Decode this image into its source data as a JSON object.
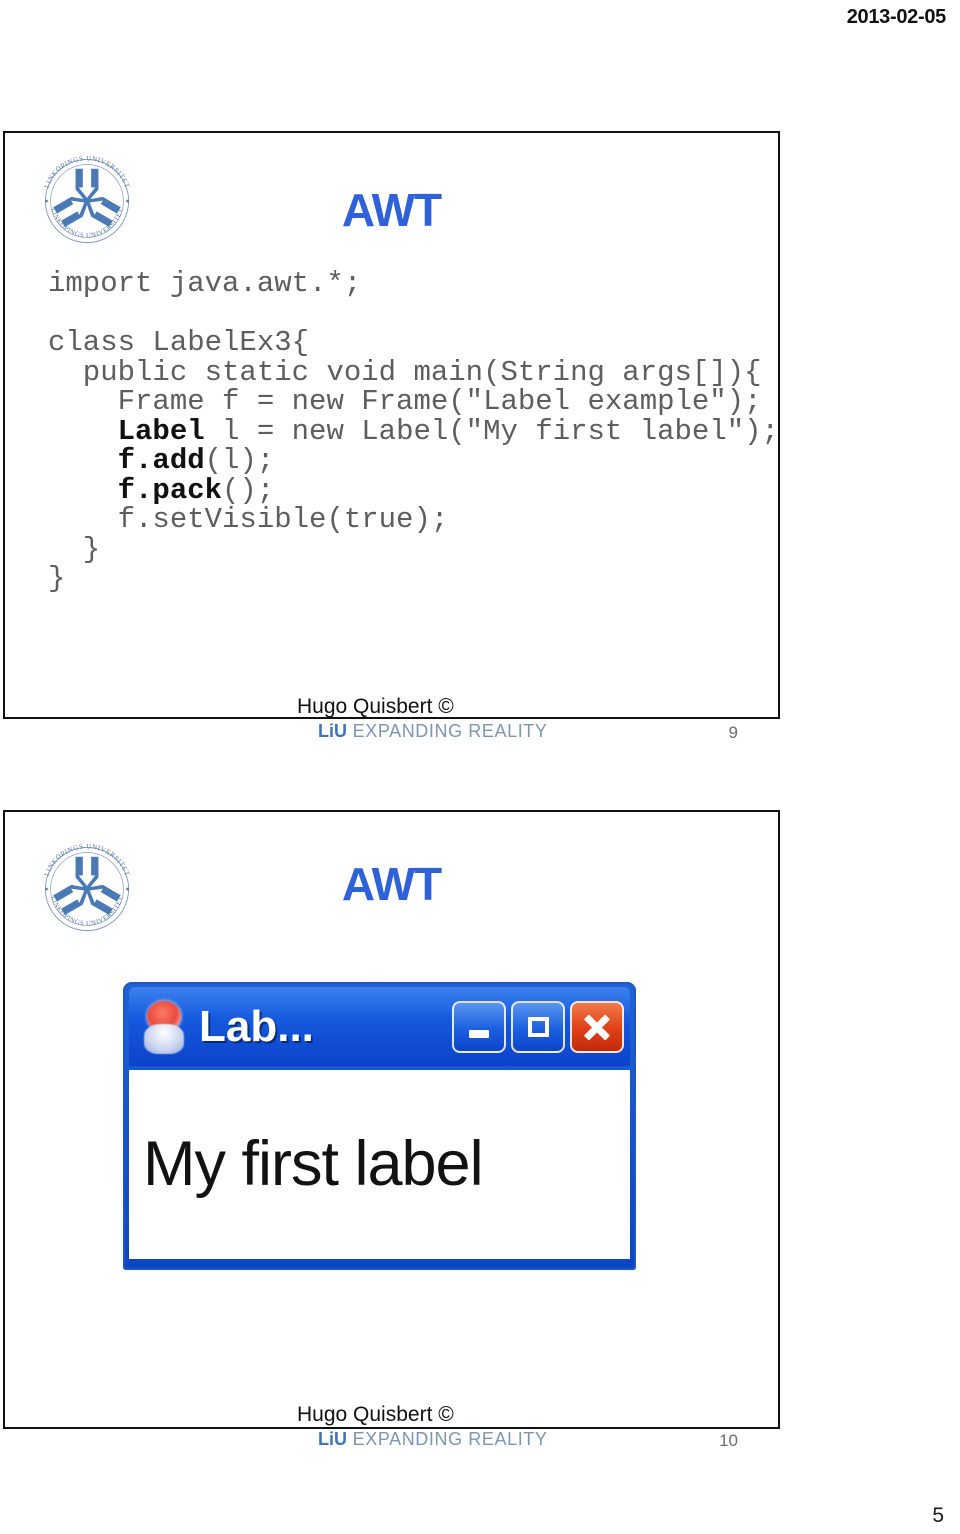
{
  "page": {
    "date": "2013-02-05",
    "page_number": "5"
  },
  "slides": [
    {
      "title": "AWT",
      "logo_alt": "LINKÖPINGS UNIVERSITET",
      "logo_ring_top": "LINKÖPINGS UNIVERSITET",
      "logo_ring_bottom": "LINKÖPINGS UNIVERSITET",
      "code_lines": [
        {
          "plain": "import java.awt.*;"
        },
        {
          "plain": ""
        },
        {
          "plain": "class LabelEx3{"
        },
        {
          "plain": "  public static void main(String args[]){"
        },
        {
          "plain": "    Frame f = new Frame(\"Label example\");"
        },
        {
          "bold": "    Label",
          "plain": " l = new Label(\"My first label\");"
        },
        {
          "bold": "    f.add",
          "plain": "(l);"
        },
        {
          "bold": "    f.pack",
          "plain": "();"
        },
        {
          "plain": "    f.setVisible(true);"
        },
        {
          "plain": "  }"
        },
        {
          "plain": "}"
        }
      ],
      "footer": {
        "author": "Hugo Quisbert ©",
        "wordmark_brand": "LiU",
        "wordmark_tagline": "EXPANDING REALITY",
        "slide_number": "9"
      }
    },
    {
      "title": "AWT",
      "logo_alt": "LINKÖPINGS UNIVERSITET",
      "window": {
        "title": "Lab...",
        "icon_name": "java-duke-icon",
        "minimize_label": "Minimize",
        "maximize_label": "Maximize",
        "close_label": "Close",
        "label_text": "My first label"
      },
      "footer": {
        "author": "Hugo Quisbert ©",
        "wordmark_brand": "LiU",
        "wordmark_tagline": "EXPANDING REALITY",
        "slide_number": "10"
      }
    }
  ]
}
